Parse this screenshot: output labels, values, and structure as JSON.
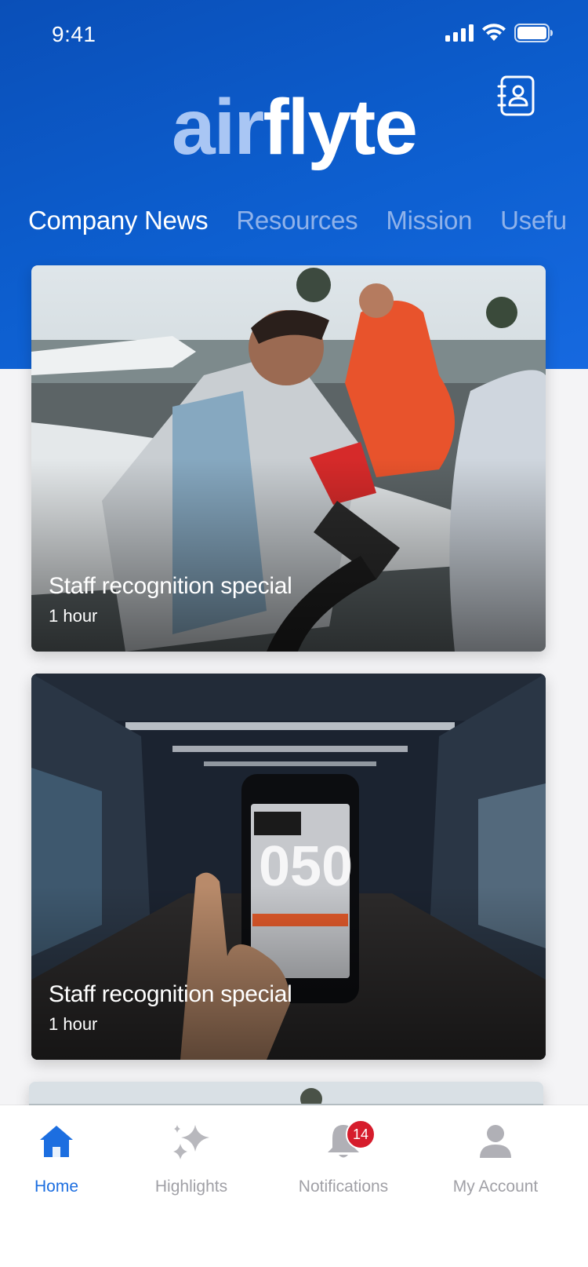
{
  "status_bar": {
    "time": "9:41"
  },
  "brand": {
    "part1": "air",
    "part2": "flyte"
  },
  "tabs": [
    {
      "label": "Company News",
      "active": true
    },
    {
      "label": "Resources",
      "active": false
    },
    {
      "label": "Mission",
      "active": false
    },
    {
      "label": "Usefu",
      "active": false
    }
  ],
  "cards": [
    {
      "title": "Staff recognition special",
      "meta": "1 hour"
    },
    {
      "title": "Staff recognition special",
      "meta": "1 hour"
    }
  ],
  "tabbar": {
    "home": "Home",
    "highlights": "Highlights",
    "notifications": "Notifications",
    "notifications_badge": "14",
    "account": "My Account"
  },
  "icons": {
    "contacts": "contact-book-icon",
    "home": "home-icon",
    "highlights": "sparkle-icon",
    "notifications": "bell-icon",
    "account": "person-icon"
  },
  "colors": {
    "brand_blue": "#0d5fd0",
    "active_tab": "#1c6ee0",
    "badge": "#d61c2c"
  }
}
